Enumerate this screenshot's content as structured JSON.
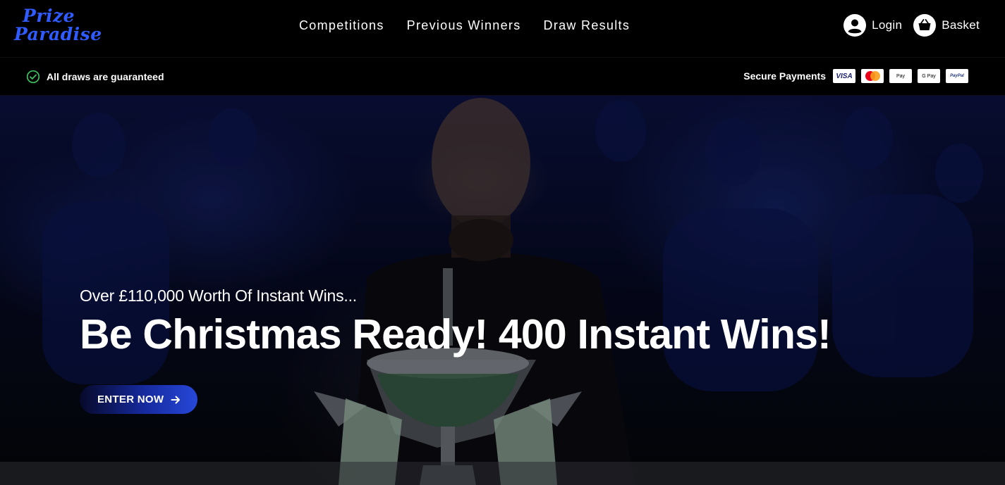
{
  "brand": {
    "logo_line1": "Prize",
    "logo_line2": "Paradise",
    "color": "#2f5bff"
  },
  "nav": {
    "items": [
      {
        "label": "Competitions"
      },
      {
        "label": "Previous Winners"
      },
      {
        "label": "Draw Results"
      }
    ]
  },
  "account": {
    "login_label": "Login",
    "basket_label": "Basket",
    "login_icon": "user-icon",
    "basket_icon": "basket-icon"
  },
  "trust": {
    "guarantee_text": "All draws are guaranteed",
    "guarantee_icon": "check-circle-icon",
    "guarantee_color": "#3fbf5f",
    "payments_label": "Secure Payments",
    "payment_methods": [
      {
        "name": "visa-icon",
        "text": "VISA"
      },
      {
        "name": "mastercard-icon",
        "text": ""
      },
      {
        "name": "apple-pay-icon",
        "text": " Pay"
      },
      {
        "name": "google-pay-icon",
        "text": "G Pay"
      },
      {
        "name": "paypal-icon",
        "text": "PayPal"
      }
    ]
  },
  "hero": {
    "subtitle": "Over £110,000 Worth Of Instant Wins...",
    "headline": "Be Christmas Ready! 400 Instant Wins!",
    "cta_label": "ENTER NOW",
    "cta_icon": "arrow-right-icon",
    "cta_gradient": [
      "#07092a",
      "#2647d8"
    ]
  }
}
